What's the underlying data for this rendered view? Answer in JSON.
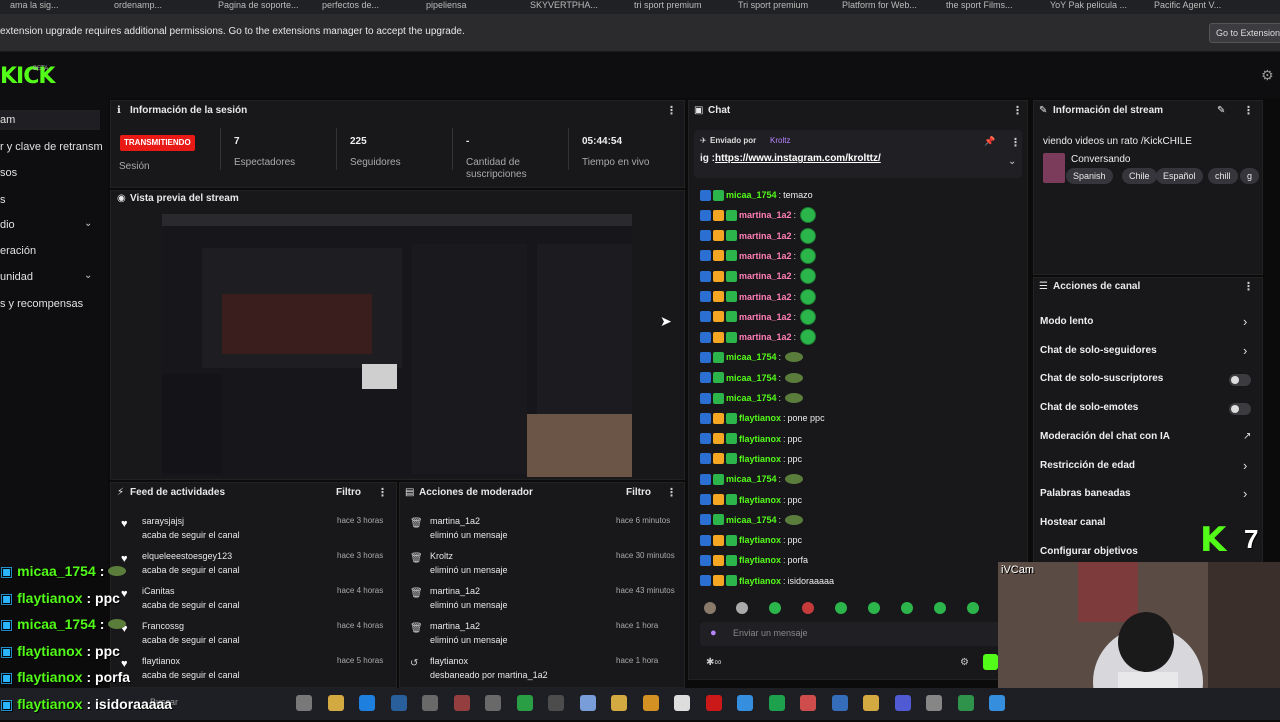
{
  "bookmarks": [
    "ama la sig...",
    "ordenamp...",
    "Pagina de soporte...",
    "perfectos de...",
    "pipeliensa",
    "SKYVERTPHA...",
    "tri sport premium",
    "Tri sport premium",
    "Platform for Web...",
    "the sport Films...",
    "YoY Pak pelicula ...",
    "Pacific Agent V..."
  ],
  "extension_bar": {
    "message": "extension upgrade requires additional permissions. Go to the extensions manager to accept the upgrade.",
    "button": "Go to Extensions"
  },
  "logo": {
    "text": "KICK",
    "badge": "BETA"
  },
  "sidebar": {
    "items": [
      {
        "label": "am",
        "active": true
      },
      {
        "label": "r y clave de retransm"
      },
      {
        "label": "sos"
      },
      {
        "label": "s"
      },
      {
        "label": "dio",
        "chevron": true
      },
      {
        "label": "eración"
      },
      {
        "label": "unidad",
        "chevron": true
      },
      {
        "label": "s y recompensas"
      }
    ]
  },
  "session": {
    "title": "Información de la sesión",
    "status_badge": "TRANSMITIENDO",
    "status_label": "Sesión",
    "stats": [
      {
        "value": "7",
        "label": "Espectadores"
      },
      {
        "value": "225",
        "label": "Seguidores"
      },
      {
        "value": "-",
        "label": "Cantidad de suscripciones"
      },
      {
        "value": "05:44:54",
        "label": "Tiempo en vivo"
      }
    ]
  },
  "preview": {
    "title": "Vista previa del stream"
  },
  "activity_feed": {
    "title": "Feed de actividades",
    "filter": "Filtro",
    "items": [
      {
        "user": "saraysjajsj",
        "action": "acaba de seguir el canal",
        "time": "hace 3 horas"
      },
      {
        "user": "elqueleeestoesgey123",
        "action": "acaba de seguir el canal",
        "time": "hace 3 horas"
      },
      {
        "user": "iCanitas",
        "action": "acaba de seguir el canal",
        "time": "hace 4 horas"
      },
      {
        "user": "Francossg",
        "action": "acaba de seguir el canal",
        "time": "hace 4 horas"
      },
      {
        "user": "flaytianox",
        "action": "acaba de seguir el canal",
        "time": "hace 5 horas"
      }
    ]
  },
  "mod_actions": {
    "title": "Acciones de moderador",
    "filter": "Filtro",
    "items": [
      {
        "user": "martina_1a2",
        "action": "eliminó un mensaje",
        "time": "hace 6 minutos"
      },
      {
        "user": "Kroltz",
        "action": "eliminó un mensaje",
        "time": "hace 30 minutos"
      },
      {
        "user": "martina_1a2",
        "action": "eliminó un mensaje",
        "time": "hace 43 minutos"
      },
      {
        "user": "martina_1a2",
        "action": "eliminó un mensaje",
        "time": "hace 1 hora"
      },
      {
        "user": "flaytianox",
        "action": "desbaneado por martina_1a2",
        "time": "hace 1 hora"
      }
    ]
  },
  "chat": {
    "title": "Chat",
    "pinned_by_label": "Enviado por",
    "pinned_by_user": "Kroltz",
    "pinned_prefix": "ig :",
    "pinned_link": "https://www.instagram.com/krolttz/",
    "messages": [
      {
        "user": "micaa_1754",
        "color": "#53fc18",
        "text": "temazo",
        "emote": ""
      },
      {
        "user": "martina_1a2",
        "color": "#ff7eb6",
        "text": "",
        "emote": "big"
      },
      {
        "user": "martina_1a2",
        "color": "#ff7eb6",
        "text": "",
        "emote": "big"
      },
      {
        "user": "martina_1a2",
        "color": "#ff7eb6",
        "text": "",
        "emote": "big"
      },
      {
        "user": "martina_1a2",
        "color": "#ff7eb6",
        "text": "",
        "emote": "big"
      },
      {
        "user": "martina_1a2",
        "color": "#ff7eb6",
        "text": "",
        "emote": "big"
      },
      {
        "user": "martina_1a2",
        "color": "#ff7eb6",
        "text": "",
        "emote": "big"
      },
      {
        "user": "martina_1a2",
        "color": "#ff7eb6",
        "text": "",
        "emote": "big"
      },
      {
        "user": "micaa_1754",
        "color": "#53fc18",
        "text": "",
        "emote": "small"
      },
      {
        "user": "micaa_1754",
        "color": "#53fc18",
        "text": "",
        "emote": "small"
      },
      {
        "user": "micaa_1754",
        "color": "#53fc18",
        "text": "",
        "emote": "small"
      },
      {
        "user": "flaytianox",
        "color": "#53fc18",
        "text": "pone ppc",
        "emote": ""
      },
      {
        "user": "flaytianox",
        "color": "#53fc18",
        "text": "ppc",
        "emote": ""
      },
      {
        "user": "flaytianox",
        "color": "#53fc18",
        "text": "ppc",
        "emote": ""
      },
      {
        "user": "micaa_1754",
        "color": "#53fc18",
        "text": "",
        "emote": "small"
      },
      {
        "user": "flaytianox",
        "color": "#53fc18",
        "text": "ppc",
        "emote": ""
      },
      {
        "user": "micaa_1754",
        "color": "#53fc18",
        "text": "",
        "emote": "small"
      },
      {
        "user": "flaytianox",
        "color": "#53fc18",
        "text": "ppc",
        "emote": ""
      },
      {
        "user": "flaytianox",
        "color": "#53fc18",
        "text": "porfa",
        "emote": ""
      },
      {
        "user": "flaytianox",
        "color": "#53fc18",
        "text": "isidoraaaaa",
        "emote": ""
      }
    ],
    "input_placeholder": "Enviar un mensaje"
  },
  "stream_info": {
    "title": "Información del stream",
    "stream_title": "viendo videos un rato /KickCHILE",
    "category": "Conversando",
    "tags": [
      "Spanish",
      "Chile",
      "Español",
      "chill",
      "g"
    ]
  },
  "channel_actions": {
    "title": "Acciones de canal",
    "items": [
      {
        "label": "Modo lento",
        "control": "chevron"
      },
      {
        "label": "Chat de solo-seguidores",
        "control": "chevron"
      },
      {
        "label": "Chat de solo-suscriptores",
        "control": "toggle"
      },
      {
        "label": "Chat de solo-emotes",
        "control": "toggle"
      },
      {
        "label": "Moderación del chat con IA",
        "control": "external"
      },
      {
        "label": "Restricción de edad",
        "control": "chevron"
      },
      {
        "label": "Palabras baneadas",
        "control": "chevron"
      },
      {
        "label": "Hostear canal",
        "control": "none"
      },
      {
        "label": "Configurar objetivos",
        "control": "none"
      }
    ]
  },
  "viewer_badge": {
    "logo": "K",
    "count": "7"
  },
  "webcam": {
    "label": "iVCam"
  },
  "overlay_chat": [
    {
      "user": "micaa_1754",
      "text": ":",
      "emote": true
    },
    {
      "user": "flaytianox",
      "text": ": ppc",
      "emote": false
    },
    {
      "user": "micaa_1754",
      "text": ":",
      "emote": true
    },
    {
      "user": "flaytianox",
      "text": ": ppc",
      "emote": false
    },
    {
      "user": "flaytianox",
      "text": ": porfa",
      "emote": false
    },
    {
      "user": "flaytianox",
      "text": ": isidoraaaaa",
      "emote": false
    }
  ],
  "taskbar": {
    "search_placeholder": "Buscar"
  },
  "colors": {
    "accent": "#53fc18",
    "live": "#e91916",
    "panel": "#18181b"
  }
}
